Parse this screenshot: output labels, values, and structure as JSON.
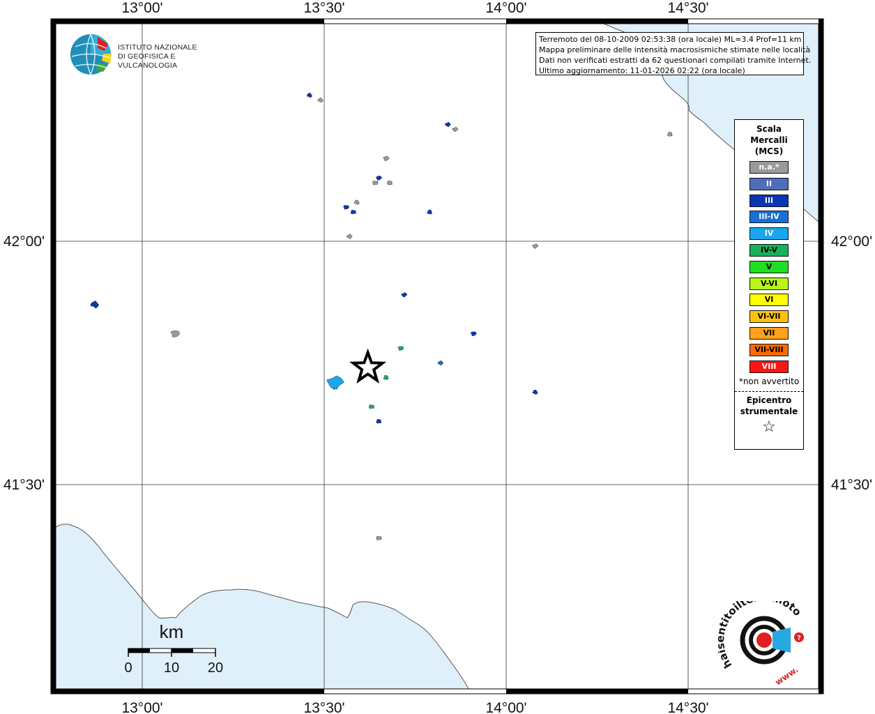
{
  "info_box": {
    "line1": "Terremoto del 08-10-2009 02:53:38 (ora locale) ML=3.4 Prof=11 km",
    "line2": "Mappa preliminare delle intensità macrosismiche stimate nelle località",
    "line3": "Dati non verificati estratti da 62 questionari compilati tramite Internet.",
    "line4": "Ultimo aggiornamento: 11-01-2026 02:22 (ora locale)"
  },
  "logo_ingv": {
    "line1": "ISTITUTO NAZIONALE",
    "line2": "DI GEOFISICA E VULCANOLOGIA"
  },
  "logo_hsit": {
    "text": "haisentitoilterremoto.it",
    "url_prefix": "www."
  },
  "axes": {
    "lon_labels": [
      "13°00'",
      "13°30'",
      "14°00'",
      "14°30'"
    ],
    "lat_labels": [
      "42°00'",
      "41°30'"
    ]
  },
  "scale_bar": {
    "unit": "km",
    "ticks": [
      "0",
      "10",
      "20"
    ]
  },
  "legend": {
    "title_line1": "Scala",
    "title_line2": "Mercalli",
    "title_line3": "(MCS)",
    "items": [
      {
        "label": "n.a.*",
        "color": "#9a9a9a",
        "text_color": "#ffffff"
      },
      {
        "label": "II",
        "color": "#4f6db8",
        "text_color": "#ffffff"
      },
      {
        "label": "III",
        "color": "#0a36b5",
        "text_color": "#ffffff"
      },
      {
        "label": "III-IV",
        "color": "#1a6fd6",
        "text_color": "#ffffff"
      },
      {
        "label": "IV",
        "color": "#1aa6ee",
        "text_color": "#ffffff"
      },
      {
        "label": "IV-V",
        "color": "#16b25c",
        "text_color": "#000000"
      },
      {
        "label": "V",
        "color": "#1fe01f",
        "text_color": "#000000"
      },
      {
        "label": "V-VI",
        "color": "#b7f51b",
        "text_color": "#000000"
      },
      {
        "label": "VI",
        "color": "#ffff00",
        "text_color": "#000000"
      },
      {
        "label": "VI-VII",
        "color": "#ffc20a",
        "text_color": "#000000"
      },
      {
        "label": "VII",
        "color": "#ffa11a",
        "text_color": "#000000"
      },
      {
        "label": "VII-VIII",
        "color": "#ff6a00",
        "text_color": "#000000"
      },
      {
        "label": "VIII",
        "color": "#ff1414",
        "text_color": "#ffffff"
      }
    ],
    "note": "*non avvertito",
    "epicenter_line1": "Epicentro",
    "epicenter_line2": "strumentale",
    "epicenter_symbol": "☆"
  },
  "colors": {
    "sea": "#e0f0fb",
    "coast": "#555555",
    "grid": "#333333",
    "frame": "#000000"
  },
  "localities": [
    {
      "intensity": "n.a.*",
      "lon": 13.49,
      "lat": 42.29
    },
    {
      "intensity": "n.a.*",
      "lon": 13.86,
      "lat": 42.23
    },
    {
      "intensity": "n.a.*",
      "lon": 13.67,
      "lat": 42.17
    },
    {
      "intensity": "n.a.*",
      "lon": 13.64,
      "lat": 42.12
    },
    {
      "intensity": "n.a.*",
      "lon": 13.68,
      "lat": 42.12
    },
    {
      "intensity": "n.a.*",
      "lon": 13.59,
      "lat": 42.08
    },
    {
      "intensity": "n.a.*",
      "lon": 13.57,
      "lat": 42.01
    },
    {
      "intensity": "n.a.*",
      "lon": 14.08,
      "lat": 41.99
    },
    {
      "intensity": "n.a.*",
      "lon": 13.09,
      "lat": 41.81
    },
    {
      "intensity": "n.a.*",
      "lon": 13.65,
      "lat": 41.39
    },
    {
      "intensity": "n.a.*",
      "lon": 14.45,
      "lat": 42.22
    },
    {
      "intensity": "III",
      "lon": 13.46,
      "lat": 42.3
    },
    {
      "intensity": "III",
      "lon": 13.84,
      "lat": 42.24
    },
    {
      "intensity": "III",
      "lon": 13.65,
      "lat": 42.13
    },
    {
      "intensity": "III",
      "lon": 13.56,
      "lat": 42.07
    },
    {
      "intensity": "III",
      "lon": 13.58,
      "lat": 42.06
    },
    {
      "intensity": "III",
      "lon": 13.79,
      "lat": 42.06
    },
    {
      "intensity": "III",
      "lon": 12.87,
      "lat": 41.87
    },
    {
      "intensity": "III",
      "lon": 13.72,
      "lat": 41.89
    },
    {
      "intensity": "III",
      "lon": 13.91,
      "lat": 41.81
    },
    {
      "intensity": "III",
      "lon": 13.53,
      "lat": 41.7
    },
    {
      "intensity": "III",
      "lon": 13.65,
      "lat": 41.63
    },
    {
      "intensity": "III",
      "lon": 14.08,
      "lat": 41.69
    },
    {
      "intensity": "III-IV",
      "lon": 13.82,
      "lat": 41.75
    },
    {
      "intensity": "IV",
      "lon": 13.53,
      "lat": 41.71
    },
    {
      "intensity": "IV-V",
      "lon": 13.71,
      "lat": 41.78
    },
    {
      "intensity": "IV-V",
      "lon": 13.63,
      "lat": 41.66
    },
    {
      "intensity": "IV-V",
      "lon": 13.67,
      "lat": 41.72
    }
  ],
  "epicenter": {
    "lon": 13.62,
    "lat": 41.74
  }
}
